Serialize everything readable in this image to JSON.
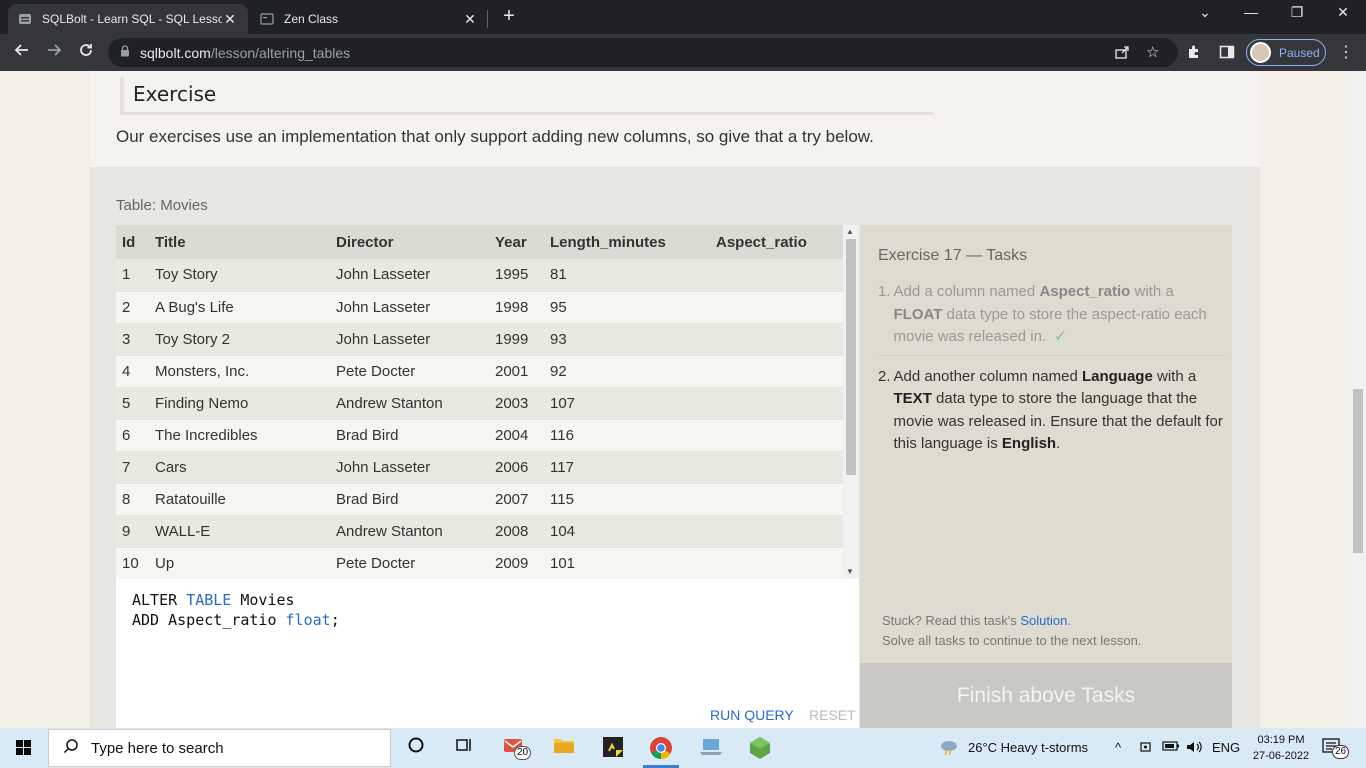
{
  "browser": {
    "tabs": [
      {
        "title": "SQLBolt - Learn SQL - SQL Lesso",
        "close": "✕"
      },
      {
        "title": "Zen Class",
        "close": "✕"
      }
    ],
    "new_tab": "+",
    "window_controls": {
      "minimize": "—",
      "restore": "❐",
      "close": "✕",
      "tab_search": "⌄"
    },
    "url_host": "sqlbolt.com",
    "url_path": "/lesson/altering_tables",
    "profile_label": "Paused"
  },
  "page": {
    "exercise_heading": "Exercise",
    "intro": "Our exercises use an implementation that only support adding new columns, so give that a try below.",
    "table_caption": "Table: Movies",
    "columns": [
      "Id",
      "Title",
      "Director",
      "Year",
      "Length_minutes",
      "Aspect_ratio"
    ],
    "rows": [
      [
        "1",
        "Toy Story",
        "John Lasseter",
        "1995",
        "81",
        ""
      ],
      [
        "2",
        "A Bug's Life",
        "John Lasseter",
        "1998",
        "95",
        ""
      ],
      [
        "3",
        "Toy Story 2",
        "John Lasseter",
        "1999",
        "93",
        ""
      ],
      [
        "4",
        "Monsters, Inc.",
        "Pete Docter",
        "2001",
        "92",
        ""
      ],
      [
        "5",
        "Finding Nemo",
        "Andrew Stanton",
        "2003",
        "107",
        ""
      ],
      [
        "6",
        "The Incredibles",
        "Brad Bird",
        "2004",
        "116",
        ""
      ],
      [
        "7",
        "Cars",
        "John Lasseter",
        "2006",
        "117",
        ""
      ],
      [
        "8",
        "Ratatouille",
        "Brad Bird",
        "2007",
        "115",
        ""
      ],
      [
        "9",
        "WALL-E",
        "Andrew Stanton",
        "2008",
        "104",
        ""
      ],
      [
        "10",
        "Up",
        "Pete Docter",
        "2009",
        "101",
        ""
      ]
    ],
    "query": {
      "line1_a": "ALTER ",
      "line1_kw": "TABLE",
      "line1_b": " Movies",
      "line2_a": "ADD Aspect_ratio ",
      "line2_kw": "float",
      "line2_b": ";"
    },
    "run_label": "RUN QUERY",
    "reset_label": "RESET",
    "tasks": {
      "title": "Exercise 17 — Tasks",
      "task1": {
        "num": "1.",
        "t1": "Add a column named ",
        "b1": "Aspect_ratio",
        "t2": " with a ",
        "b2": "FLOAT",
        "t3": " data type to store the aspect-ratio each movie was released in.",
        "check": "✓"
      },
      "task2": {
        "num": "2.",
        "t1": "Add another column named ",
        "b1": "Language",
        "t2": " with a ",
        "b2": "TEXT",
        "t3": " data type to store the language that the movie was released in. Ensure that the default for this language is ",
        "b3": "English",
        "t4": "."
      },
      "stuck_prefix": "Stuck? Read this task's ",
      "stuck_link": "Solution",
      "stuck_suffix": ".",
      "solve_all": "Solve all tasks to continue to the next lesson.",
      "finish_label": "Finish above Tasks"
    }
  },
  "taskbar": {
    "search_placeholder": "Type here to search",
    "mail_badge": "20",
    "weather": "26°C  Heavy t-storms",
    "language": "ENG",
    "time": "03:19 PM",
    "date": "27-06-2022",
    "notifications": "26"
  }
}
